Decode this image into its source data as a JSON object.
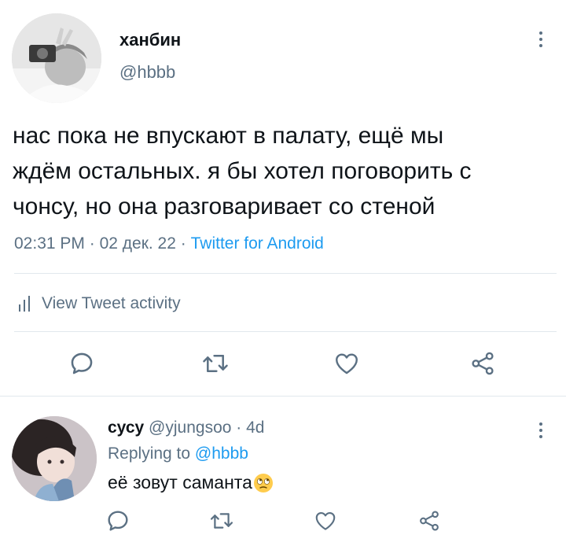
{
  "tweet": {
    "display_name": "ханбин",
    "handle": "@hbbb",
    "text_lines": [
      "нас пока не впускают в палату, ещё мы",
      "ждём остальных. я бы хотел поговорить с",
      "чонсу, но она разговаривает со стеной"
    ],
    "time": "02:31 PM",
    "date": "02 дек. 22",
    "separator": "·",
    "source": "Twitter for Android",
    "activity_label": "View Tweet activity"
  },
  "reply": {
    "display_name": "сусу",
    "handle": "@yjungsoo",
    "age": "4d",
    "separator": "·",
    "replying_prefix": "Replying to",
    "replying_to": "@hbbb",
    "text": "её зовут саманта",
    "emoji": "face-with-rolling-eyes-icon"
  },
  "colors": {
    "text": "#0f1419",
    "secondary": "#5b7083",
    "link": "#1d9bf0",
    "divider": "#e1e8ed"
  }
}
